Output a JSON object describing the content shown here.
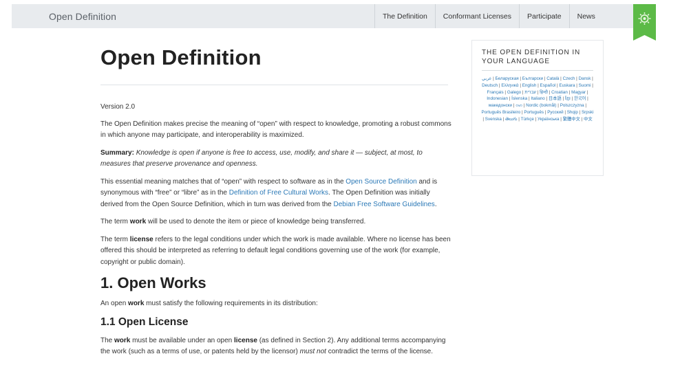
{
  "header": {
    "brand": "Open Definition",
    "nav": [
      "The Definition",
      "Conformant Licenses",
      "Participate",
      "News"
    ],
    "badge_color": "#5cba47"
  },
  "article": {
    "title": "Open Definition",
    "version": "Version 2.0",
    "intro": "The Open Definition makes precise the meaning of “open” with respect to knowledge, promoting a robust commons in which anyone may participate, and interoperability is maximized.",
    "summary_label": "Summary:",
    "summary_text": "Knowledge is open if anyone is free to access, use, modify, and share it — subject, at most, to measures that preserve provenance and openness.",
    "para3": {
      "t1": "This essential meaning matches that of “open” with respect to software as in the ",
      "l1": "Open Source Definition",
      "t2": " and is synonymous with “free” or “libre” as in the ",
      "l2": "Definition of Free Cultural Works",
      "t3": ". The Open Definition was initially derived from the Open Source Definition, which in turn was derived from the ",
      "l3": "Debian Free Software Guidelines",
      "t4": "."
    },
    "para4": {
      "t1": "The term ",
      "b1": "work",
      "t2": " will be used to denote the item or piece of knowledge being transferred."
    },
    "para5": {
      "t1": "The term ",
      "b1": "license",
      "t2": " refers to the legal conditions under which the work is made available. Where no license has been offered this should be interpreted as referring to default legal conditions governing use of the work (for example, copyright or public domain)."
    },
    "section1_title": "1. Open Works",
    "section1_para": {
      "t1": "An open ",
      "b1": "work",
      "t2": " must satisfy the following requirements in its distribution:"
    },
    "section11_title": "1.1 Open License",
    "section11_para": {
      "t1": "The ",
      "b1": "work",
      "t2": " must be available under an open ",
      "b2": "license",
      "t3": " (as defined in Section 2). Any additional terms accompanying the work (such as a terms of use, or patents held by the licensor) ",
      "i1": "must not",
      "t4": " contradict the terms of the license."
    }
  },
  "sidebar": {
    "title": "THE OPEN DEFINITION IN YOUR LANGUAGE",
    "languages": [
      "عربي",
      "Беларуская",
      "Български",
      "Català",
      "Czech",
      "Dansk",
      "Deutsch",
      "Ελληνικά",
      "English",
      "Español",
      "Euskara",
      "Suomi",
      "Français",
      "Galego",
      "עברית",
      "हिन्दी",
      "Croatian",
      "Magyar",
      "Indonesian",
      "Íslenska",
      "Italiano",
      "日本語",
      "ខ្មែរ",
      "한국어",
      "македонски",
      "ဗမာ",
      "Nordic (bokmål)",
      "Polszczyzna",
      "Português Brasileiro",
      "Português",
      "Русский",
      "Shqip",
      "Srpski",
      "Svenska",
      "తెలుగు",
      "Türkçe",
      "Українська",
      "繁體中文",
      "中文"
    ]
  }
}
